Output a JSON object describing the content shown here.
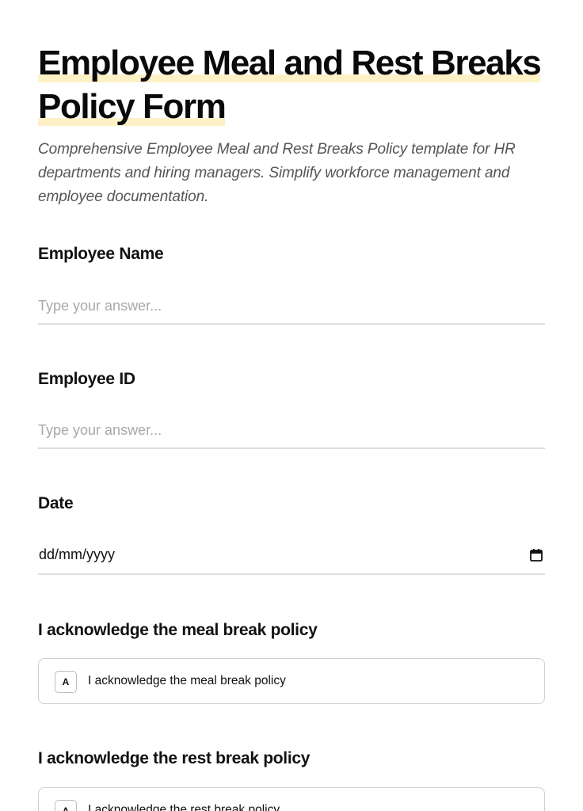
{
  "form": {
    "title_line1": "Employee Meal and Rest Breaks",
    "title_line2": "Policy Form",
    "description": "Comprehensive Employee Meal and Rest Breaks Policy template for HR departments and hiring managers. Simplify workforce management and employee documentation."
  },
  "questions": [
    {
      "label": "Employee Name",
      "type": "text",
      "placeholder": "Type your answer..."
    },
    {
      "label": "Employee ID",
      "type": "text",
      "placeholder": "Type your answer..."
    },
    {
      "label": "Date",
      "type": "date",
      "value": "dd/mm/yyyy",
      "icon": "calendar-icon"
    },
    {
      "label": "I acknowledge the meal break policy",
      "type": "choice",
      "options": [
        {
          "key": "A",
          "label": "I acknowledge the meal break policy"
        }
      ]
    },
    {
      "label": "I acknowledge the rest break policy",
      "type": "choice",
      "options": [
        {
          "key": "A",
          "label": "I acknowledge the rest break policy"
        }
      ]
    }
  ],
  "colors": {
    "title_highlight": "#fdf1c6",
    "input_border": "#dedede",
    "placeholder": "#a8a8a8",
    "choice_border": "#cfcfcf"
  }
}
